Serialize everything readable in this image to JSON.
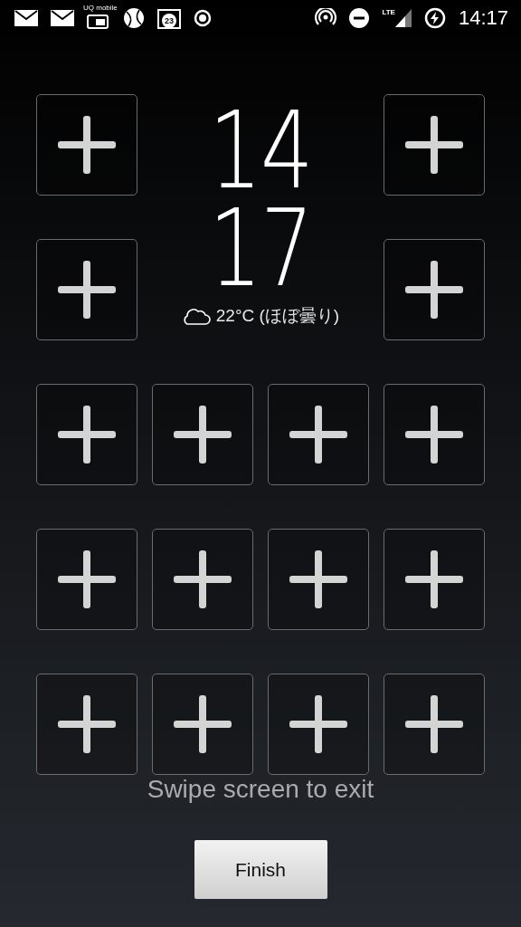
{
  "status_bar": {
    "sim_label": "UQ mobile",
    "calendar_day": "23",
    "network": "LTE",
    "time": "14:17"
  },
  "clock": {
    "hour": "14",
    "minute": "17"
  },
  "weather": {
    "text": "22°C (ほぼ曇り)"
  },
  "slots": [
    {
      "kind": "add"
    },
    {
      "kind": "add"
    },
    {
      "kind": "add"
    },
    {
      "kind": "add"
    },
    {
      "kind": "add"
    },
    {
      "kind": "add"
    },
    {
      "kind": "add"
    },
    {
      "kind": "add"
    },
    {
      "kind": "add"
    },
    {
      "kind": "add"
    },
    {
      "kind": "add"
    },
    {
      "kind": "add"
    },
    {
      "kind": "add"
    },
    {
      "kind": "add"
    },
    {
      "kind": "add"
    },
    {
      "kind": "add"
    }
  ],
  "hint": "Swipe screen to exit",
  "button": "Finish"
}
